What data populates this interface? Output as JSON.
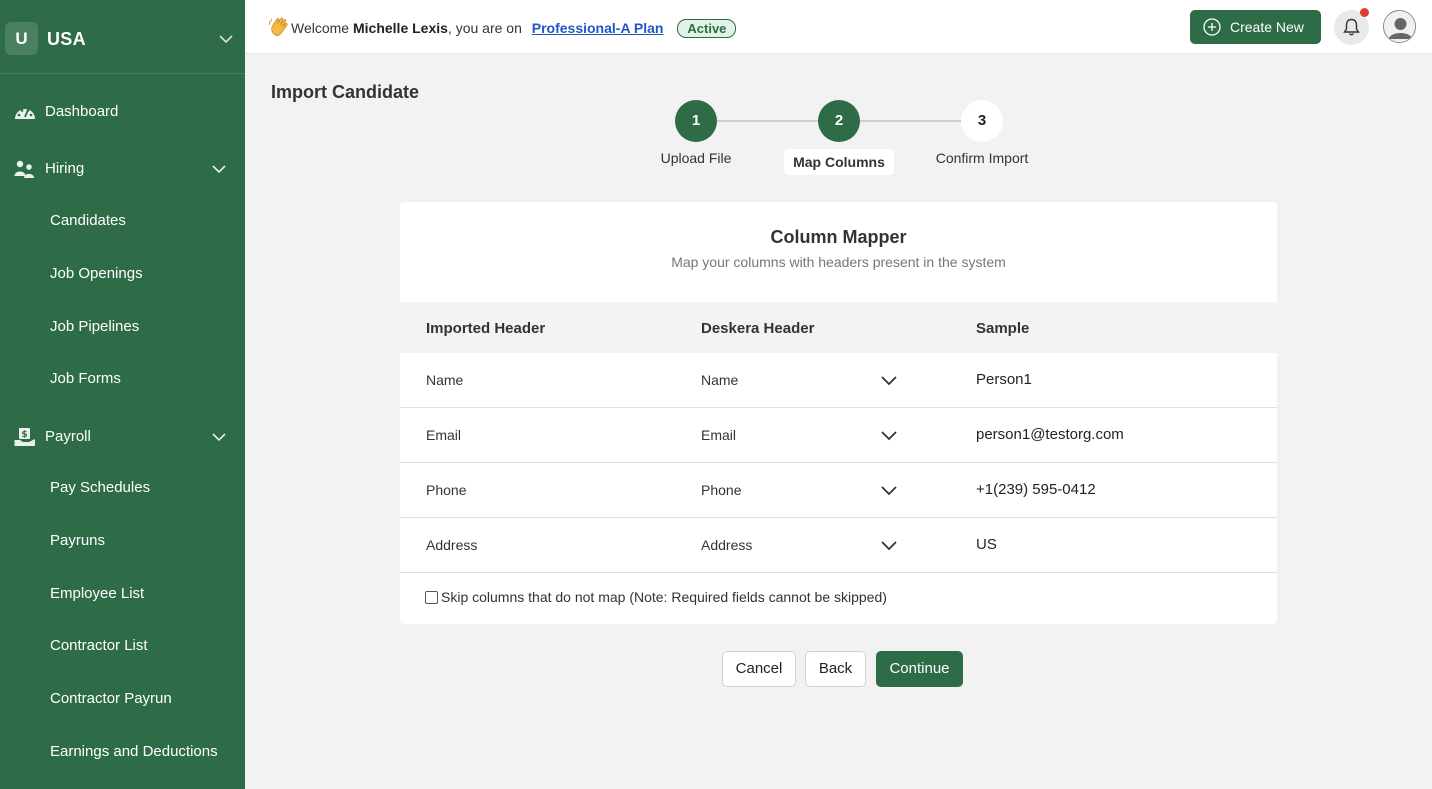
{
  "sidebar": {
    "org_initial": "U",
    "org_name": "USA",
    "dashboard": "Dashboard",
    "hiring": "Hiring",
    "hiring_items": [
      "Candidates",
      "Job Openings",
      "Job Pipelines",
      "Job Forms"
    ],
    "payroll": "Payroll",
    "payroll_items": [
      "Pay Schedules",
      "Payruns",
      "Employee List",
      "Contractor List",
      "Contractor Payrun",
      "Earnings and Deductions"
    ]
  },
  "header": {
    "welcome_prefix": "Welcome",
    "user_name": "Michelle Lexis",
    "plan_prefix": ", you are on",
    "plan_name": "Professional-A Plan",
    "plan_status": "Active",
    "create_label": "Create New"
  },
  "page": {
    "title": "Import Candidate"
  },
  "stepper": {
    "steps": [
      {
        "number": "1",
        "label": "Upload File",
        "state": "done"
      },
      {
        "number": "2",
        "label": "Map Columns",
        "state": "current"
      },
      {
        "number": "3",
        "label": "Confirm Import",
        "state": "todo"
      }
    ]
  },
  "mapper": {
    "title": "Column Mapper",
    "subtitle": "Map your columns with headers present in the system",
    "columns": [
      "Imported Header",
      "Deskera Header",
      "Sample"
    ],
    "rows": [
      {
        "imported": "Name",
        "deskera": "Name",
        "sample": "Person1"
      },
      {
        "imported": "Email",
        "deskera": "Email",
        "sample": "person1@testorg.com"
      },
      {
        "imported": "Phone",
        "deskera": "Phone",
        "sample": "+1(239) 595-0412"
      },
      {
        "imported": "Address",
        "deskera": "Address",
        "sample": "US"
      }
    ],
    "skip_label": "Skip columns that do not map (Note: Required fields cannot be skipped)"
  },
  "actions": {
    "cancel": "Cancel",
    "back": "Back",
    "continue": "Continue"
  },
  "colors": {
    "brand": "#2e6b47",
    "link": "#1f57c3",
    "notification": "#e23a2e"
  }
}
